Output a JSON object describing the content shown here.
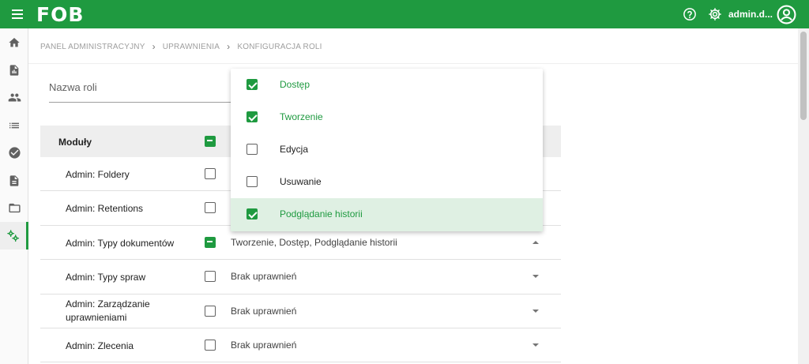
{
  "app": {
    "logo": "FOB",
    "username": "admin.d..."
  },
  "topbar": {
    "help_icon": "help-circle-icon",
    "settings_icon": "gear-icon",
    "avatar_icon": "account-circle-icon",
    "menu_icon": "hamburger-menu-icon",
    "color": "#1f9a40"
  },
  "sidebar": {
    "items": [
      {
        "icon": "home-icon"
      },
      {
        "icon": "document-report-icon"
      },
      {
        "icon": "users-icon"
      },
      {
        "icon": "list-icon"
      },
      {
        "icon": "check-circle-icon"
      },
      {
        "icon": "document-icon"
      },
      {
        "icon": "folder-open-icon"
      },
      {
        "icon": "gears-icon",
        "active": true
      }
    ]
  },
  "breadcrumb": [
    "PANEL ADMINISTRACYJNY",
    "UPRAWNIENIA",
    "KONFIGURACJA ROLI"
  ],
  "role_input": {
    "placeholder": "Nazwa roli",
    "value": ""
  },
  "table": {
    "header": {
      "label": "Moduły",
      "checkbox": "indeterminate"
    },
    "rows": [
      {
        "name": "Admin: Foldery",
        "checkbox": "unchecked",
        "perm": ""
      },
      {
        "name": "Admin: Retentions",
        "checkbox": "unchecked",
        "perm": ""
      },
      {
        "name": "Admin: Typy dokumentów",
        "checkbox": "indeterminate",
        "perm": "Tworzenie, Dostęp, Podglądanie historii",
        "expanded": true
      },
      {
        "name": "Admin: Typy spraw",
        "checkbox": "unchecked",
        "perm": "Brak uprawnień"
      },
      {
        "name": "Admin: Zarządzanie uprawnieniami",
        "checkbox": "unchecked",
        "perm": "Brak uprawnień"
      },
      {
        "name": "Admin: Zlecenia",
        "checkbox": "unchecked",
        "perm": "Brak uprawnień"
      }
    ]
  },
  "dropdown": {
    "options": [
      {
        "label": "Dostęp",
        "checked": true
      },
      {
        "label": "Tworzenie",
        "checked": true
      },
      {
        "label": "Edycja",
        "checked": false
      },
      {
        "label": "Usuwanie",
        "checked": false
      },
      {
        "label": "Podglądanie historii",
        "checked": true,
        "highlighted": true
      }
    ]
  }
}
